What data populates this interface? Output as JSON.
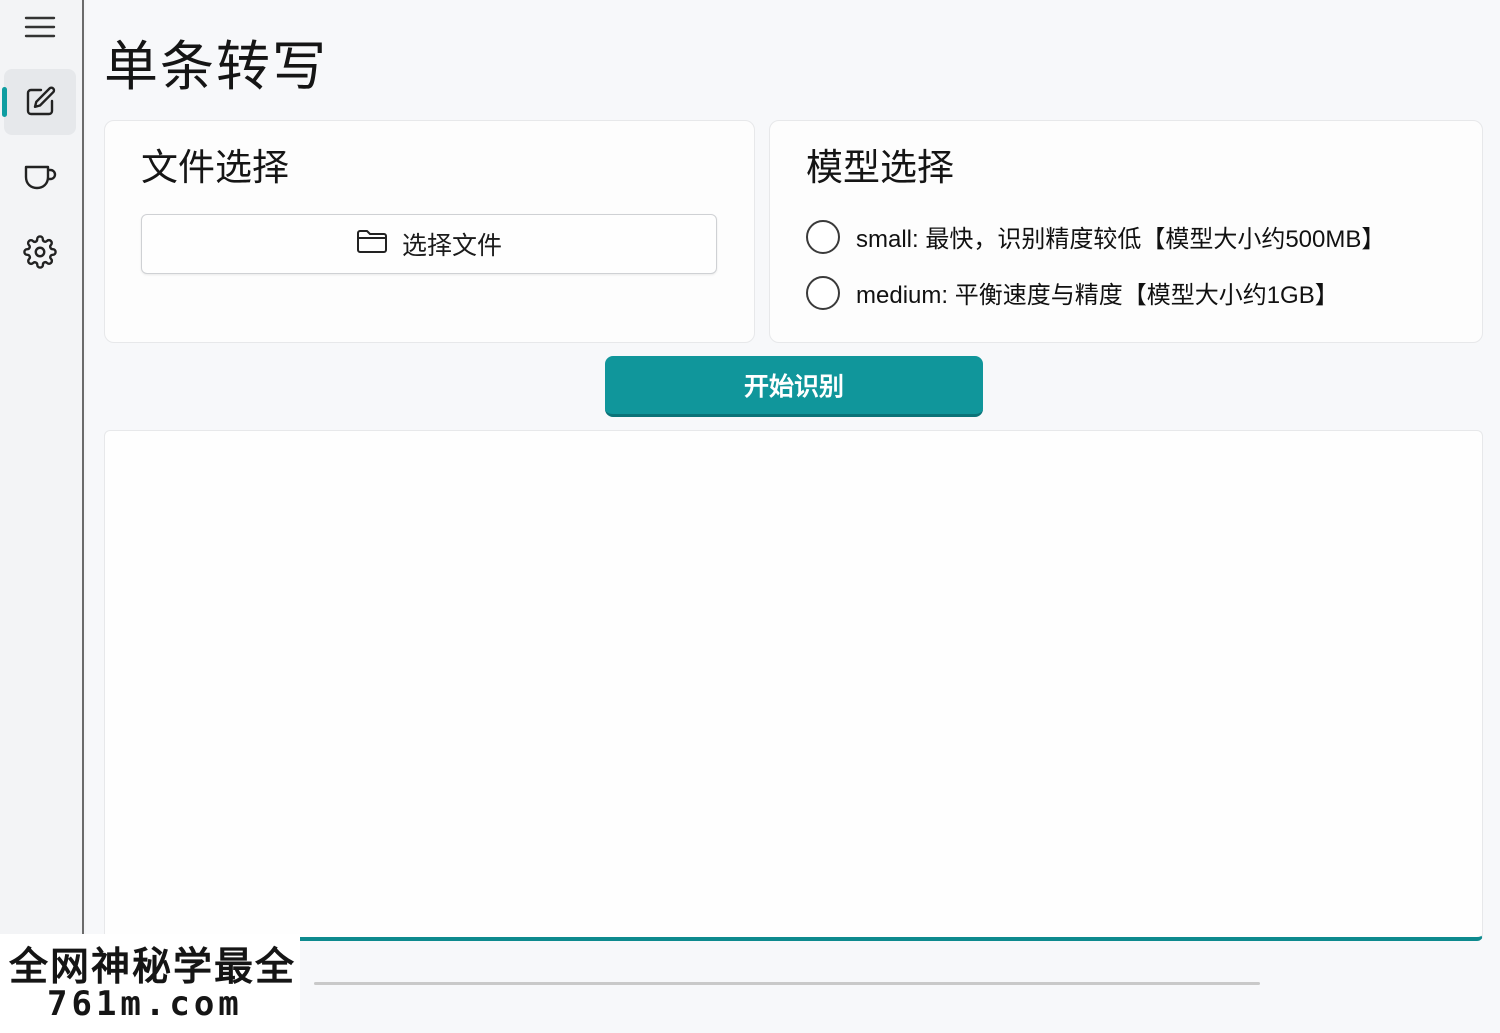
{
  "sidebar": {
    "items": [
      {
        "name": "menu",
        "icon": "hamburger-menu-icon"
      },
      {
        "name": "transcribe",
        "icon": "edit-icon",
        "active": true
      },
      {
        "name": "cup",
        "icon": "cup-icon"
      },
      {
        "name": "settings",
        "icon": "gear-icon"
      }
    ],
    "accent_color": "#0f9da1"
  },
  "page": {
    "title": "单条转写"
  },
  "file_card": {
    "title": "文件选择",
    "button_label": "选择文件",
    "button_icon": "folder-icon"
  },
  "model_card": {
    "title": "模型选择",
    "options": [
      {
        "label": "small: 最快，识别精度较低【模型大小约500MB】",
        "selected": false
      },
      {
        "label": "medium: 平衡速度与精度【模型大小约1GB】",
        "selected": false
      }
    ]
  },
  "actions": {
    "start_label": "开始识别",
    "start_color": "#10969b"
  },
  "output": {
    "text": ""
  },
  "watermark": {
    "line1": "全网神秘学最全",
    "line2": "761m.com"
  }
}
